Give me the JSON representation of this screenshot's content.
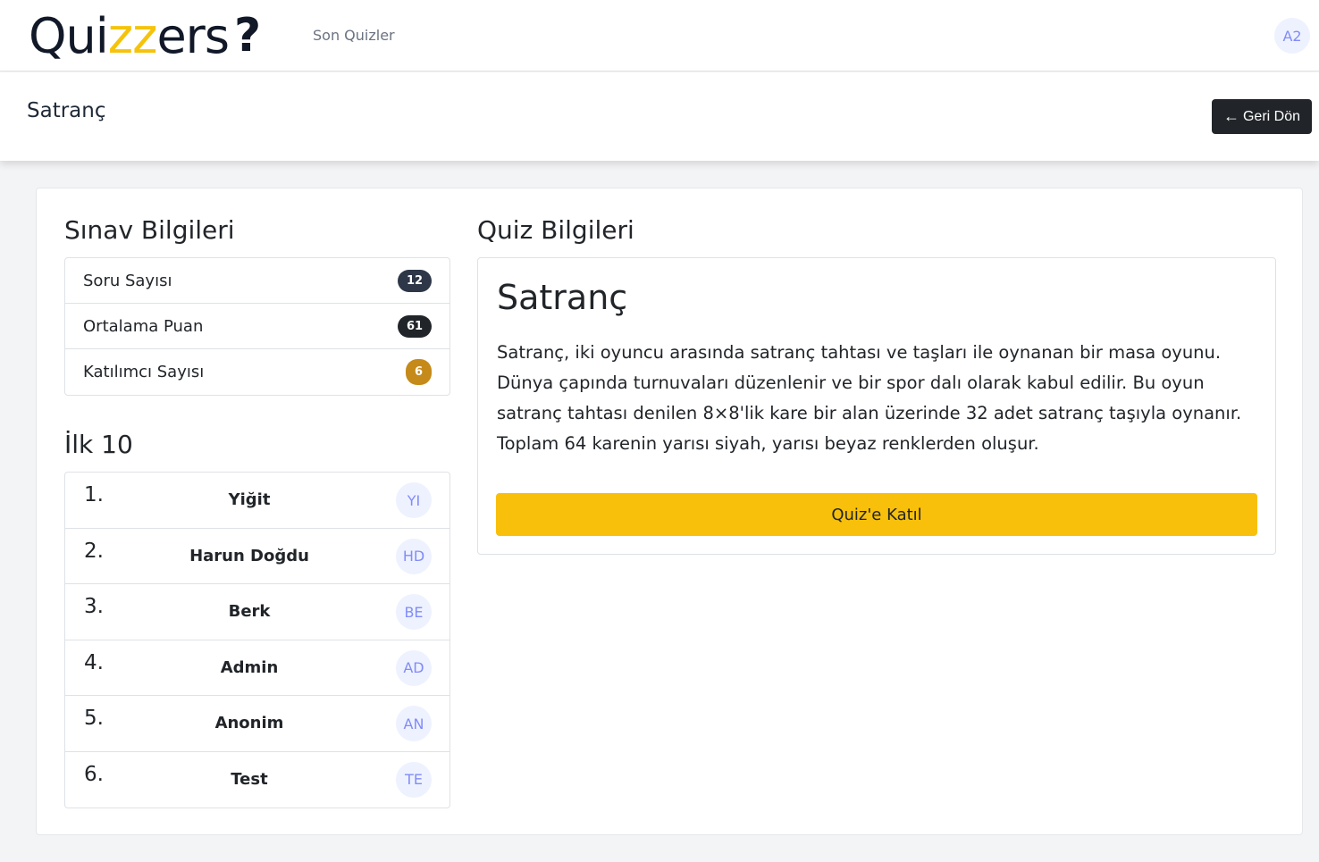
{
  "nav": {
    "logo_part1": "Qui",
    "logo_part2": "zz",
    "logo_part3": "ers",
    "logo_mark": "?",
    "recent_link": "Son Quizler",
    "user_initials": "A2"
  },
  "header": {
    "title": "Satranç",
    "back_label": "Geri Dön",
    "back_icon": "arrow-left-icon"
  },
  "exam_info": {
    "title": "Sınav Bilgileri",
    "items": [
      {
        "label": "Soru Sayısı",
        "value": "12"
      },
      {
        "label": "Ortalama Puan",
        "value": "61"
      },
      {
        "label": "Katılımcı Sayısı",
        "value": "6"
      }
    ]
  },
  "top10": {
    "title": "İlk 10",
    "entries": [
      {
        "rank": "1.",
        "name": "Yiğit",
        "initials": "YI"
      },
      {
        "rank": "2.",
        "name": "Harun Doğdu",
        "initials": "HD"
      },
      {
        "rank": "3.",
        "name": "Berk",
        "initials": "BE"
      },
      {
        "rank": "4.",
        "name": "Admin",
        "initials": "AD"
      },
      {
        "rank": "5.",
        "name": "Anonim",
        "initials": "AN"
      },
      {
        "rank": "6.",
        "name": "Test",
        "initials": "TE"
      }
    ]
  },
  "quiz_info": {
    "section_title": "Quiz Bilgileri",
    "title": "Satranç",
    "description": "Satranç, iki oyuncu arasında satranç tahtası ve taşları ile oynanan bir masa oyunu. Dünya çapında turnuvaları düzenlenir ve bir spor dalı olarak kabul edilir. Bu oyun satranç tahtası denilen 8×8'lik kare bir alan üzerinde 32 adet satranç taşıyla oynanır. Toplam 64 karenin yarısı siyah, yarısı beyaz renklerden oluşur.",
    "join_label": "Quiz'e Katıl"
  },
  "colors": {
    "accent_yellow": "#f8c00a",
    "dark": "#212529",
    "badge_amber": "#c58a1a",
    "avatar_bg": "#eef2ff",
    "avatar_text": "#818cf8"
  }
}
